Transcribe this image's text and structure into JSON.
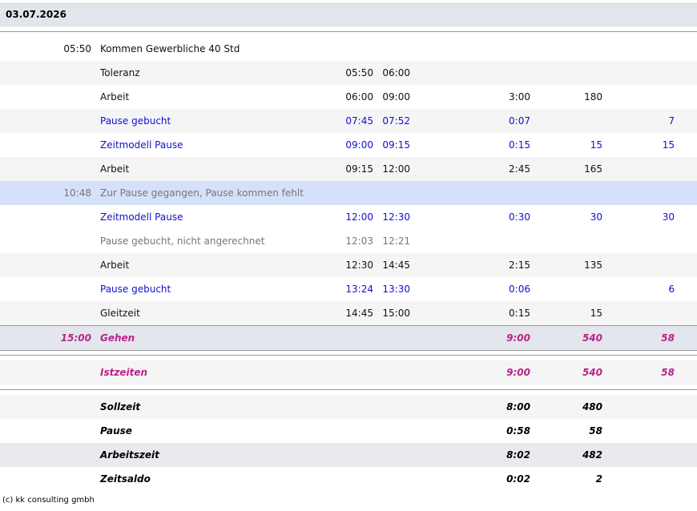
{
  "date": "03.07.2026",
  "rows": [
    {
      "time": "05:50",
      "text": "Kommen Gewerbliche 40 Std",
      "from": "",
      "to": "",
      "dur": "",
      "min": "",
      "extra": ""
    },
    {
      "time": "",
      "text": "Toleranz",
      "from": "05:50",
      "to": "06:00",
      "dur": "",
      "min": "",
      "extra": ""
    },
    {
      "time": "",
      "text": "Arbeit",
      "from": "06:00",
      "to": "09:00",
      "dur": "3:00",
      "min": "180",
      "extra": ""
    },
    {
      "time": "",
      "text": "Pause gebucht",
      "from": "07:45",
      "to": "07:52",
      "dur": "0:07",
      "min": "",
      "extra": "7"
    },
    {
      "time": "",
      "text": "Zeitmodell Pause",
      "from": "09:00",
      "to": "09:15",
      "dur": "0:15",
      "min": "15",
      "extra": "15"
    },
    {
      "time": "",
      "text": "Arbeit",
      "from": "09:15",
      "to": "12:00",
      "dur": "2:45",
      "min": "165",
      "extra": ""
    },
    {
      "time": "10:48",
      "text": "Zur Pause gegangen, Pause kommen fehlt",
      "from": "",
      "to": "",
      "dur": "",
      "min": "",
      "extra": ""
    },
    {
      "time": "",
      "text": "Zeitmodell Pause",
      "from": "12:00",
      "to": "12:30",
      "dur": "0:30",
      "min": "30",
      "extra": "30"
    },
    {
      "time": "",
      "text": "Pause gebucht, nicht angerechnet",
      "from": "12:03",
      "to": "12:21",
      "dur": "",
      "min": "",
      "extra": ""
    },
    {
      "time": "",
      "text": "Arbeit",
      "from": "12:30",
      "to": "14:45",
      "dur": "2:15",
      "min": "135",
      "extra": ""
    },
    {
      "time": "",
      "text": "Pause gebucht",
      "from": "13:24",
      "to": "13:30",
      "dur": "0:06",
      "min": "",
      "extra": "6"
    },
    {
      "time": "",
      "text": "Gleitzeit",
      "from": "14:45",
      "to": "15:00",
      "dur": "0:15",
      "min": "15",
      "extra": ""
    }
  ],
  "gehen": {
    "time": "15:00",
    "text": "Gehen",
    "dur": "9:00",
    "min": "540",
    "extra": "58"
  },
  "istzeiten": {
    "text": "Istzeiten",
    "dur": "9:00",
    "min": "540",
    "extra": "58"
  },
  "summary": [
    {
      "text": "Sollzeit",
      "dur": "8:00",
      "min": "480"
    },
    {
      "text": "Pause",
      "dur": "0:58",
      "min": "58"
    },
    {
      "text": "Arbeitszeit",
      "dur": "8:02",
      "min": "482"
    },
    {
      "text": "Zeitsaldo",
      "dur": "0:02",
      "min": "2"
    }
  ],
  "footer": "(c) kk consulting gmbh"
}
